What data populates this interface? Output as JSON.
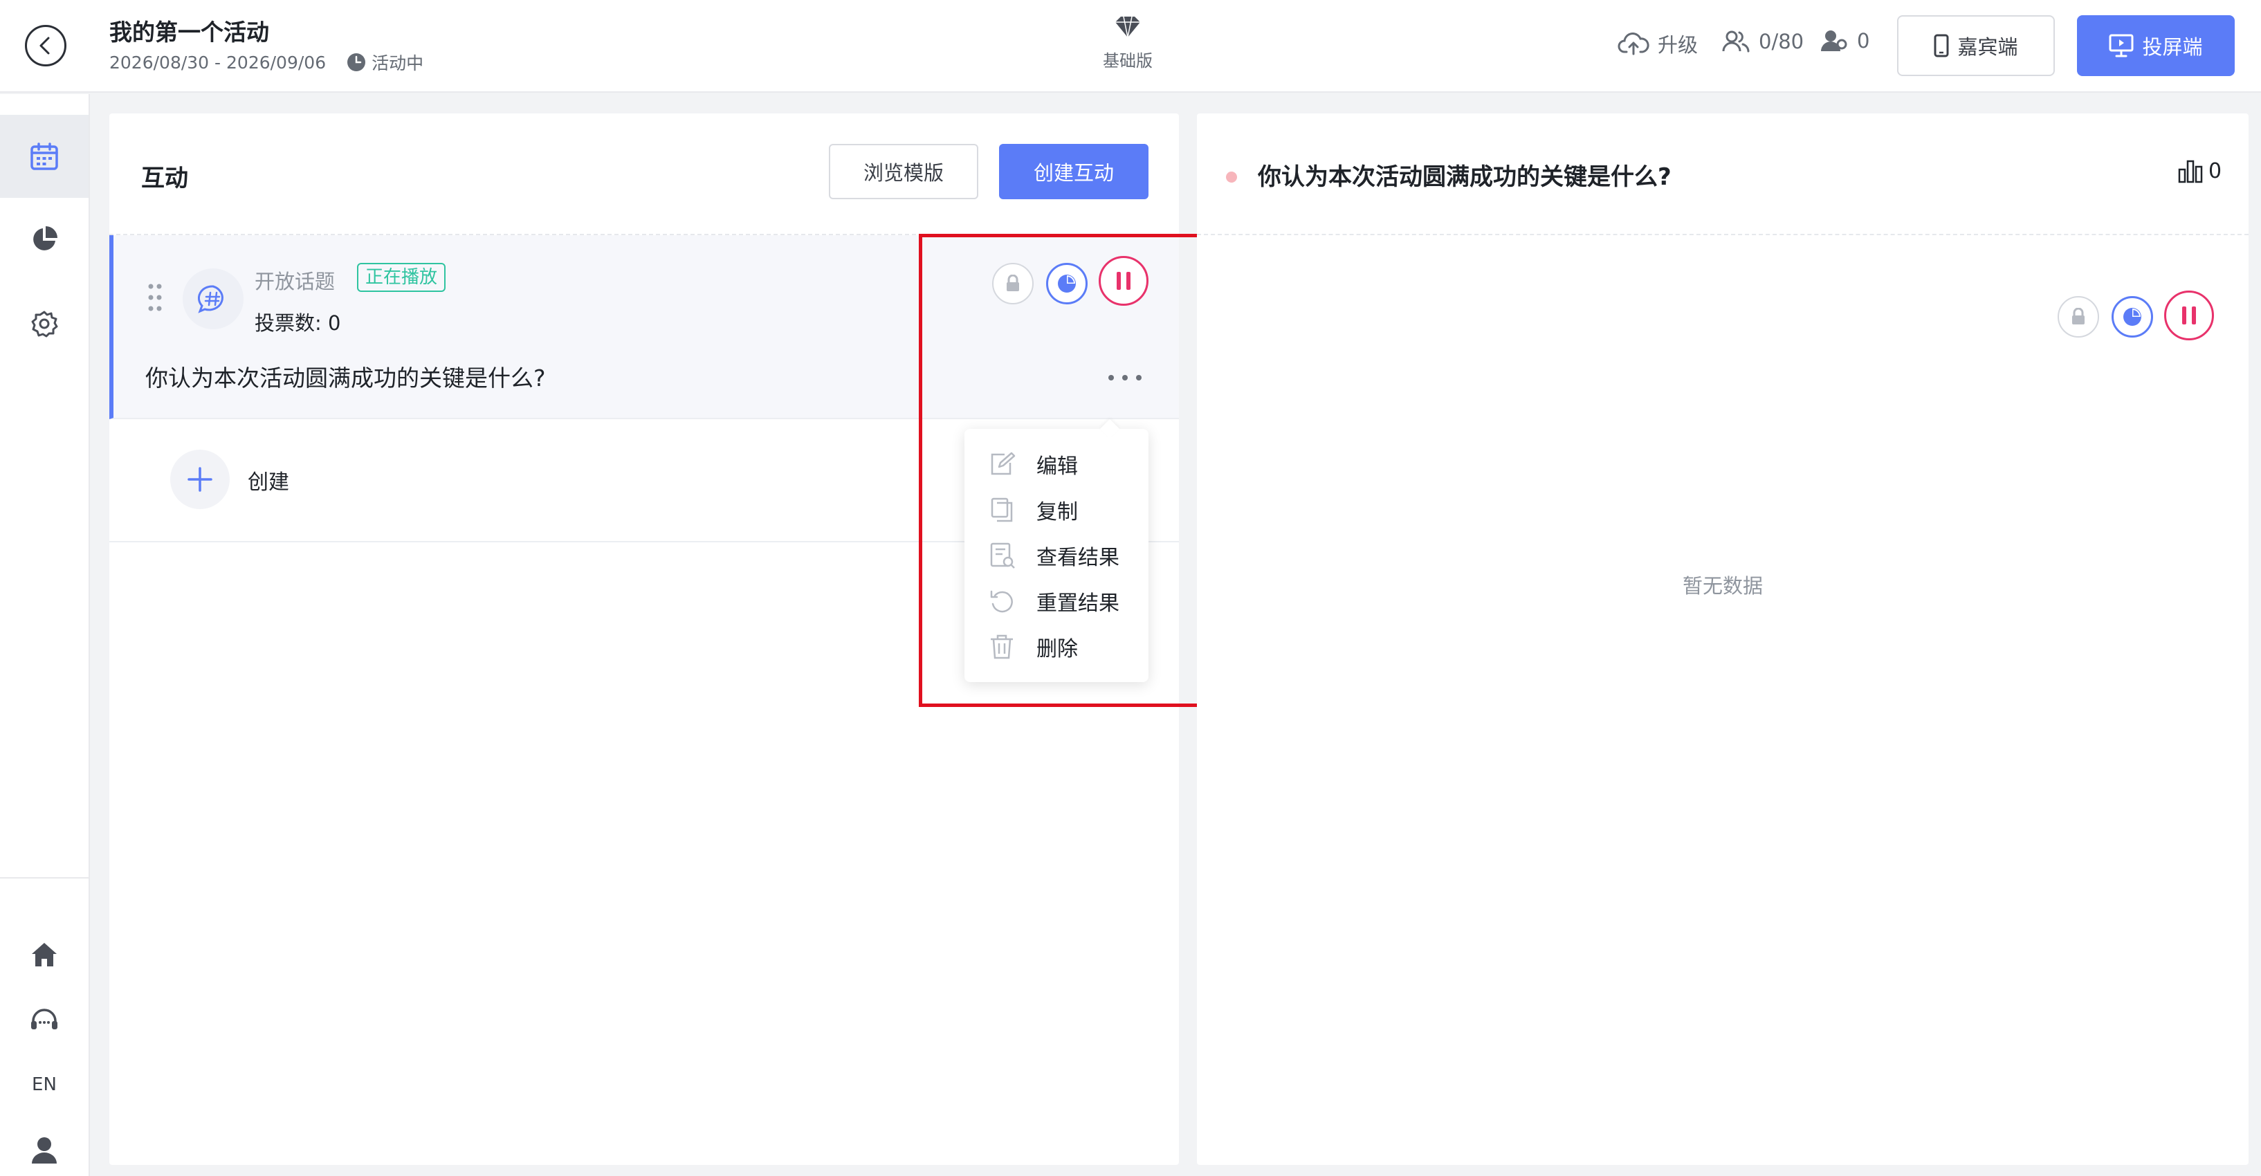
{
  "header": {
    "event_title": "我的第一个活动",
    "date_range": "2026/08/30 - 2026/09/06",
    "status": "活动中",
    "plan_label": "基础版",
    "upgrade_label": "升级",
    "participants": "0/80",
    "online_count": "0",
    "guest_button": "嘉宾端",
    "screen_button": "投屏端"
  },
  "sidebar": {
    "lang_label": "EN"
  },
  "left_panel": {
    "title": "互动",
    "browse_button": "浏览模版",
    "create_button": "创建互动",
    "item": {
      "type_label": "开放话题",
      "badge": "正在播放",
      "vote_count": "投票数: 0",
      "question": "你认为本次活动圆满成功的关键是什么?"
    },
    "create_label": "创建"
  },
  "menu": {
    "items": [
      {
        "label": "编辑",
        "icon": "edit-icon"
      },
      {
        "label": "复制",
        "icon": "copy-icon"
      },
      {
        "label": "查看结果",
        "icon": "view-results-icon"
      },
      {
        "label": "重置结果",
        "icon": "reset-icon"
      },
      {
        "label": "删除",
        "icon": "delete-icon"
      }
    ]
  },
  "right_panel": {
    "question": "你认为本次活动圆满成功的关键是什么?",
    "response_count": "0",
    "empty_text": "暂无数据"
  },
  "colors": {
    "accent": "#5b7cf7",
    "live_badge": "#2fc4a0",
    "stop": "#e8326b",
    "highlight": "#e0101f"
  }
}
